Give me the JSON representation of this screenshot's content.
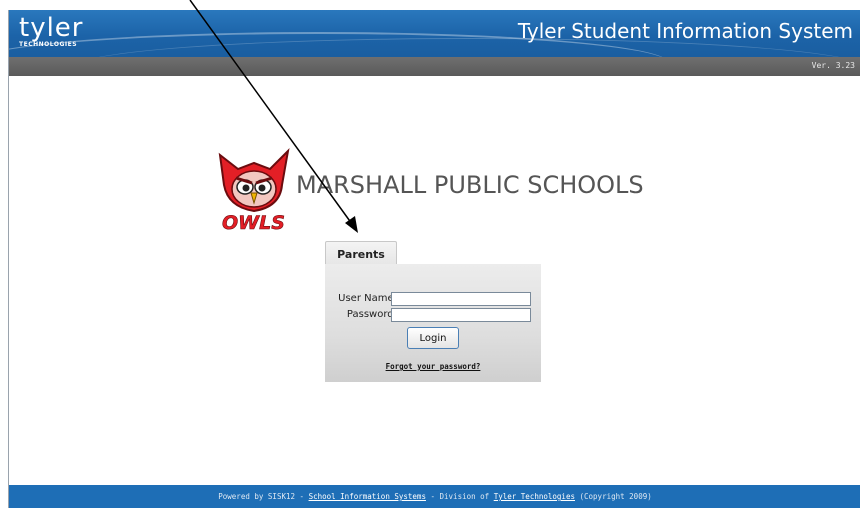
{
  "header": {
    "logo_word": "tyler",
    "logo_sub": "TECHNOLOGIES",
    "app_title": "Tyler Student Information System",
    "version": "Ver. 3.23"
  },
  "school": {
    "name": "MARSHALL PUBLIC SCHOOLS",
    "mascot_text": "OWLS"
  },
  "login": {
    "tab_label": "Parents",
    "username_label": "User Name:",
    "username_value": "",
    "password_label": "Password:",
    "password_value": "",
    "login_button": "Login",
    "forgot_link": "Forgot your password?"
  },
  "footer": {
    "prefix": "Powered by SISK12 - ",
    "link1": "School Information Systems",
    "middle": " - Division of ",
    "link2": "Tyler Technologies",
    "suffix": "  (Copyright 2009)"
  },
  "colors": {
    "header_blue": "#1c63a8",
    "version_bar": "#666666",
    "footer_blue": "#1e6eb6",
    "owl_red": "#e31f26"
  }
}
